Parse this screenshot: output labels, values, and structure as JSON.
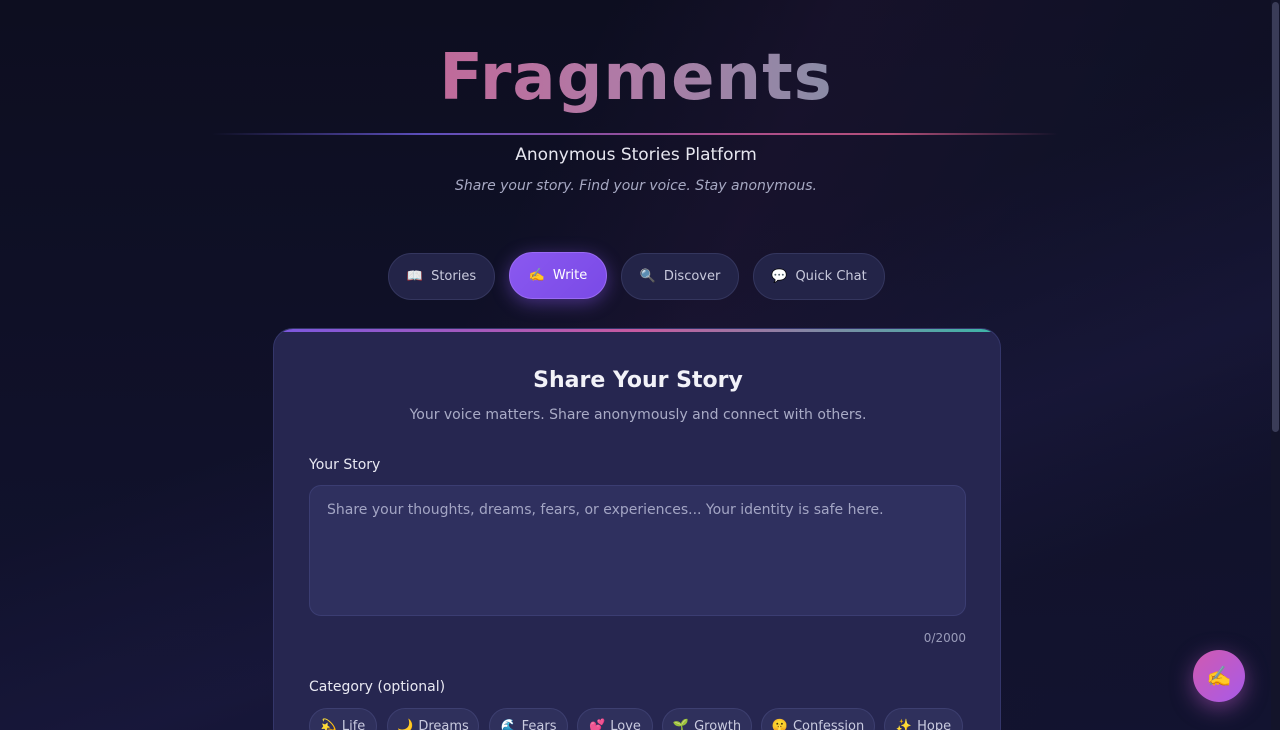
{
  "header": {
    "brand": "Fragments",
    "subtitle": "Anonymous Stories Platform",
    "tagline": "Share your story. Find your voice. Stay anonymous."
  },
  "tabs": [
    {
      "icon": "📖",
      "icon_name": "book-icon",
      "label": "Stories",
      "active": false
    },
    {
      "icon": "✍️",
      "icon_name": "writing-hand-icon",
      "label": "Write",
      "active": true
    },
    {
      "icon": "🔍",
      "icon_name": "magnifier-icon",
      "label": "Discover",
      "active": false
    },
    {
      "icon": "💬",
      "icon_name": "speech-bubble-icon",
      "label": "Quick Chat",
      "active": false
    }
  ],
  "form": {
    "title": "Share Your Story",
    "subtitle": "Your voice matters. Share anonymously and connect with others.",
    "story_label": "Your Story",
    "story_placeholder": "Share your thoughts, dreams, fears, or experiences... Your identity is safe here.",
    "story_value": "",
    "counter": "0/2000",
    "category_label": "Category (optional)",
    "categories": [
      {
        "icon": "💫",
        "icon_name": "dizzy-star-icon",
        "label": "Life"
      },
      {
        "icon": "🌙",
        "icon_name": "crescent-moon-icon",
        "label": "Dreams"
      },
      {
        "icon": "🌊",
        "icon_name": "wave-icon",
        "label": "Fears"
      },
      {
        "icon": "💕",
        "icon_name": "two-hearts-icon",
        "label": "Love"
      },
      {
        "icon": "🌱",
        "icon_name": "seedling-icon",
        "label": "Growth"
      },
      {
        "icon": "🤫",
        "icon_name": "shushing-face-icon",
        "label": "Confession"
      },
      {
        "icon": "✨",
        "icon_name": "sparkles-icon",
        "label": "Hope"
      }
    ]
  },
  "fab": {
    "icon": "✍️",
    "icon_name": "writing-hand-icon"
  },
  "colors": {
    "background": "#0e0f22",
    "card": "#262650",
    "accent_purple": "#8a58f0",
    "accent_pink": "#c65aa0",
    "accent_teal": "#3ab8a8"
  }
}
